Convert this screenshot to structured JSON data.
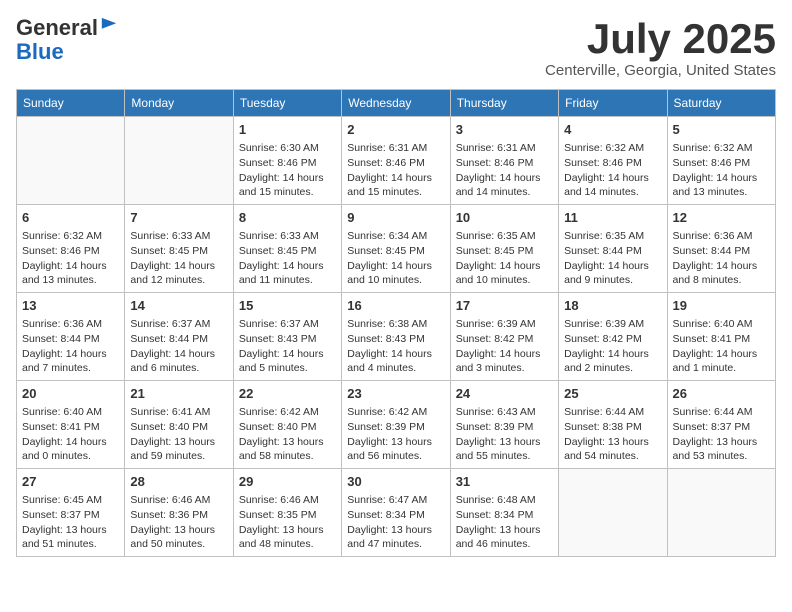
{
  "header": {
    "logo_general": "General",
    "logo_blue": "Blue",
    "month": "July 2025",
    "location": "Centerville, Georgia, United States"
  },
  "weekdays": [
    "Sunday",
    "Monday",
    "Tuesday",
    "Wednesday",
    "Thursday",
    "Friday",
    "Saturday"
  ],
  "weeks": [
    [
      {
        "day": "",
        "info": ""
      },
      {
        "day": "",
        "info": ""
      },
      {
        "day": "1",
        "info": "Sunrise: 6:30 AM\nSunset: 8:46 PM\nDaylight: 14 hours and 15 minutes."
      },
      {
        "day": "2",
        "info": "Sunrise: 6:31 AM\nSunset: 8:46 PM\nDaylight: 14 hours and 15 minutes."
      },
      {
        "day": "3",
        "info": "Sunrise: 6:31 AM\nSunset: 8:46 PM\nDaylight: 14 hours and 14 minutes."
      },
      {
        "day": "4",
        "info": "Sunrise: 6:32 AM\nSunset: 8:46 PM\nDaylight: 14 hours and 14 minutes."
      },
      {
        "day": "5",
        "info": "Sunrise: 6:32 AM\nSunset: 8:46 PM\nDaylight: 14 hours and 13 minutes."
      }
    ],
    [
      {
        "day": "6",
        "info": "Sunrise: 6:32 AM\nSunset: 8:46 PM\nDaylight: 14 hours and 13 minutes."
      },
      {
        "day": "7",
        "info": "Sunrise: 6:33 AM\nSunset: 8:45 PM\nDaylight: 14 hours and 12 minutes."
      },
      {
        "day": "8",
        "info": "Sunrise: 6:33 AM\nSunset: 8:45 PM\nDaylight: 14 hours and 11 minutes."
      },
      {
        "day": "9",
        "info": "Sunrise: 6:34 AM\nSunset: 8:45 PM\nDaylight: 14 hours and 10 minutes."
      },
      {
        "day": "10",
        "info": "Sunrise: 6:35 AM\nSunset: 8:45 PM\nDaylight: 14 hours and 10 minutes."
      },
      {
        "day": "11",
        "info": "Sunrise: 6:35 AM\nSunset: 8:44 PM\nDaylight: 14 hours and 9 minutes."
      },
      {
        "day": "12",
        "info": "Sunrise: 6:36 AM\nSunset: 8:44 PM\nDaylight: 14 hours and 8 minutes."
      }
    ],
    [
      {
        "day": "13",
        "info": "Sunrise: 6:36 AM\nSunset: 8:44 PM\nDaylight: 14 hours and 7 minutes."
      },
      {
        "day": "14",
        "info": "Sunrise: 6:37 AM\nSunset: 8:44 PM\nDaylight: 14 hours and 6 minutes."
      },
      {
        "day": "15",
        "info": "Sunrise: 6:37 AM\nSunset: 8:43 PM\nDaylight: 14 hours and 5 minutes."
      },
      {
        "day": "16",
        "info": "Sunrise: 6:38 AM\nSunset: 8:43 PM\nDaylight: 14 hours and 4 minutes."
      },
      {
        "day": "17",
        "info": "Sunrise: 6:39 AM\nSunset: 8:42 PM\nDaylight: 14 hours and 3 minutes."
      },
      {
        "day": "18",
        "info": "Sunrise: 6:39 AM\nSunset: 8:42 PM\nDaylight: 14 hours and 2 minutes."
      },
      {
        "day": "19",
        "info": "Sunrise: 6:40 AM\nSunset: 8:41 PM\nDaylight: 14 hours and 1 minute."
      }
    ],
    [
      {
        "day": "20",
        "info": "Sunrise: 6:40 AM\nSunset: 8:41 PM\nDaylight: 14 hours and 0 minutes."
      },
      {
        "day": "21",
        "info": "Sunrise: 6:41 AM\nSunset: 8:40 PM\nDaylight: 13 hours and 59 minutes."
      },
      {
        "day": "22",
        "info": "Sunrise: 6:42 AM\nSunset: 8:40 PM\nDaylight: 13 hours and 58 minutes."
      },
      {
        "day": "23",
        "info": "Sunrise: 6:42 AM\nSunset: 8:39 PM\nDaylight: 13 hours and 56 minutes."
      },
      {
        "day": "24",
        "info": "Sunrise: 6:43 AM\nSunset: 8:39 PM\nDaylight: 13 hours and 55 minutes."
      },
      {
        "day": "25",
        "info": "Sunrise: 6:44 AM\nSunset: 8:38 PM\nDaylight: 13 hours and 54 minutes."
      },
      {
        "day": "26",
        "info": "Sunrise: 6:44 AM\nSunset: 8:37 PM\nDaylight: 13 hours and 53 minutes."
      }
    ],
    [
      {
        "day": "27",
        "info": "Sunrise: 6:45 AM\nSunset: 8:37 PM\nDaylight: 13 hours and 51 minutes."
      },
      {
        "day": "28",
        "info": "Sunrise: 6:46 AM\nSunset: 8:36 PM\nDaylight: 13 hours and 50 minutes."
      },
      {
        "day": "29",
        "info": "Sunrise: 6:46 AM\nSunset: 8:35 PM\nDaylight: 13 hours and 48 minutes."
      },
      {
        "day": "30",
        "info": "Sunrise: 6:47 AM\nSunset: 8:34 PM\nDaylight: 13 hours and 47 minutes."
      },
      {
        "day": "31",
        "info": "Sunrise: 6:48 AM\nSunset: 8:34 PM\nDaylight: 13 hours and 46 minutes."
      },
      {
        "day": "",
        "info": ""
      },
      {
        "day": "",
        "info": ""
      }
    ]
  ]
}
